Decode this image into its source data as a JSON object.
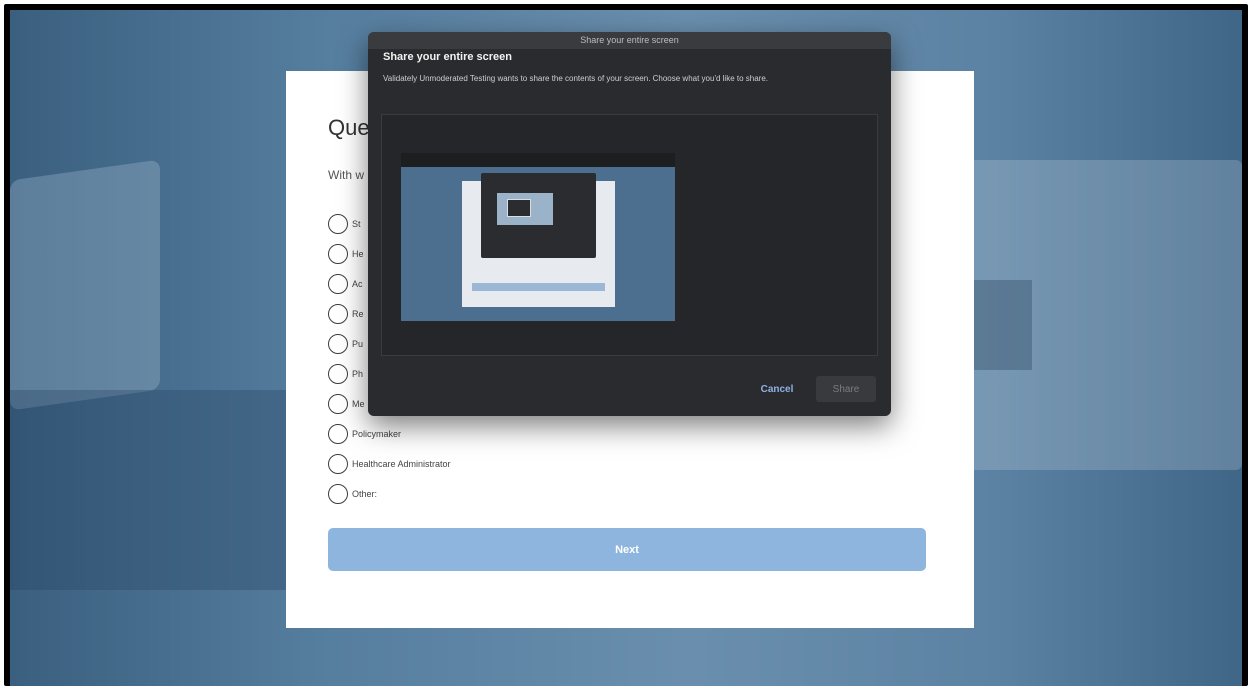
{
  "survey": {
    "title_fragment": "Que",
    "prompt_fragment": "With w",
    "options": [
      {
        "label": "St"
      },
      {
        "label": "He"
      },
      {
        "label": "Ac"
      },
      {
        "label": "Re"
      },
      {
        "label": "Pu"
      },
      {
        "label": "Ph"
      },
      {
        "label": "Me"
      },
      {
        "label": "Policymaker"
      },
      {
        "label": "Healthcare Administrator"
      },
      {
        "label": "Other:"
      }
    ],
    "next_label": "Next"
  },
  "dialog": {
    "window_title": "Share your entire screen",
    "heading": "Share your entire screen",
    "description": "Validately Unmoderated Testing wants to share the contents of your screen. Choose what you'd like to share.",
    "cancel_label": "Cancel",
    "share_label": "Share"
  },
  "colors": {
    "primary_button": "#8eb5dd",
    "dialog_bg": "#2a2b2e",
    "cancel_text": "#8fb2e3"
  }
}
